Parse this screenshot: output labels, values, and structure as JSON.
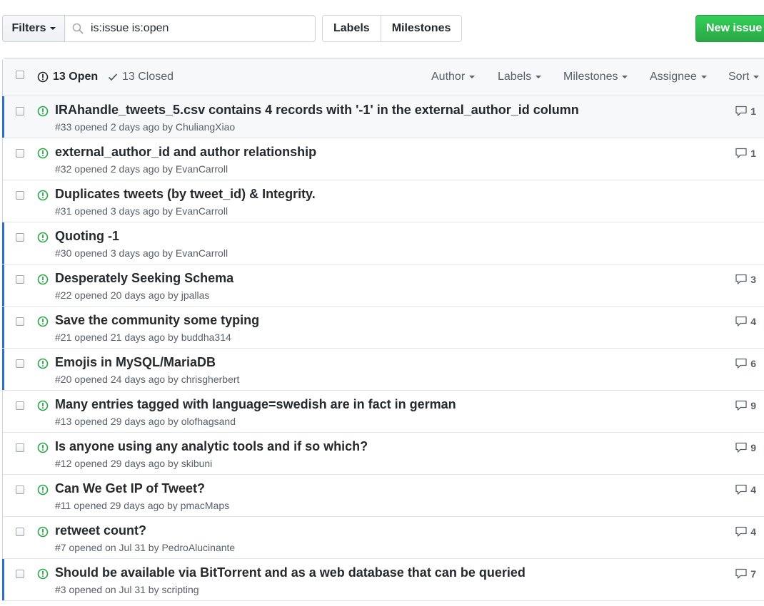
{
  "toolbar": {
    "filters_label": "Filters",
    "search_value": "is:issue is:open",
    "labels_label": "Labels",
    "milestones_label": "Milestones",
    "new_issue_label": "New issue"
  },
  "header": {
    "open_label": "13 Open",
    "closed_label": "13 Closed",
    "menus": [
      {
        "label": "Author"
      },
      {
        "label": "Labels"
      },
      {
        "label": "Milestones"
      },
      {
        "label": "Assignee"
      },
      {
        "label": "Sort"
      }
    ]
  },
  "colors": {
    "open_green": "#28a745",
    "marker_blue": "#2d6fd1",
    "text": "#24292e",
    "muted": "#586069"
  },
  "icons": {
    "search": "search-icon",
    "open": "issue-opened-icon",
    "closed": "check-icon",
    "comment": "comment-icon"
  },
  "issues": [
    {
      "title": "IRAhandle_tweets_5.csv contains 4 records with '-1' in the external_author_id column",
      "meta": "#33 opened 2 days ago by ChuliangXiao",
      "comments": "1",
      "marked": true,
      "highlighted": true
    },
    {
      "title": "external_author_id and author relationship",
      "meta": "#32 opened 2 days ago by EvanCarroll",
      "comments": "1",
      "marked": false,
      "highlighted": false
    },
    {
      "title": "Duplicates tweets (by tweet_id) & Integrity.",
      "meta": "#31 opened 3 days ago by EvanCarroll",
      "comments": "",
      "marked": false,
      "highlighted": false
    },
    {
      "title": "Quoting -1",
      "meta": "#30 opened 3 days ago by EvanCarroll",
      "comments": "",
      "marked": true,
      "highlighted": false
    },
    {
      "title": "Desperately Seeking Schema",
      "meta": "#22 opened 20 days ago by jpallas",
      "comments": "3",
      "marked": true,
      "highlighted": false
    },
    {
      "title": "Save the community some typing",
      "meta": "#21 opened 21 days ago by buddha314",
      "comments": "4",
      "marked": true,
      "highlighted": false
    },
    {
      "title": "Emojis in MySQL/MariaDB",
      "meta": "#20 opened 24 days ago by chrisgherbert",
      "comments": "6",
      "marked": true,
      "highlighted": false
    },
    {
      "title": "Many entries tagged with language=swedish are in fact in german",
      "meta": "#13 opened 29 days ago by olofhagsand",
      "comments": "9",
      "marked": false,
      "highlighted": false
    },
    {
      "title": "Is anyone using any analytic tools and if so which?",
      "meta": "#12 opened 29 days ago by skibuni",
      "comments": "9",
      "marked": false,
      "highlighted": false
    },
    {
      "title": "Can We Get IP of Tweet?",
      "meta": "#11 opened 29 days ago by pmacMaps",
      "comments": "4",
      "marked": false,
      "highlighted": false
    },
    {
      "title": "retweet count?",
      "meta": "#7 opened on Jul 31 by PedroAlucinante",
      "comments": "4",
      "marked": false,
      "highlighted": false
    },
    {
      "title": "Should be available via BitTorrent and as a web database that can be queried",
      "meta": "#3 opened on Jul 31 by scripting",
      "comments": "7",
      "marked": true,
      "highlighted": false
    }
  ]
}
